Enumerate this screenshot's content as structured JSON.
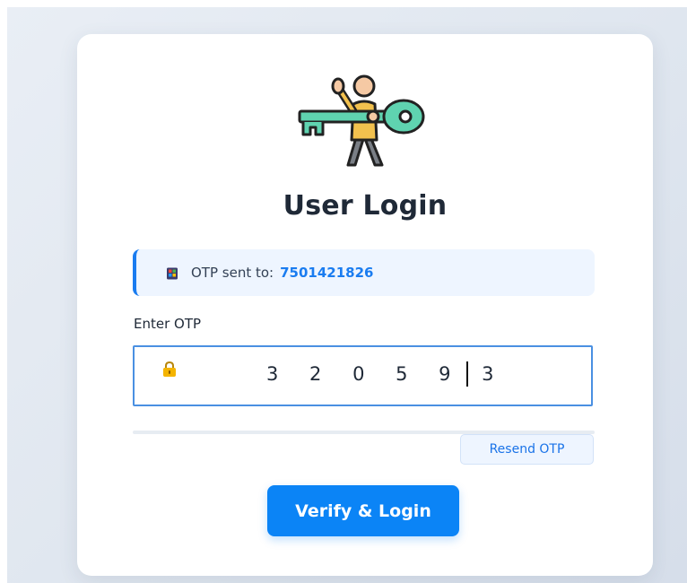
{
  "header": {
    "title": "User Login",
    "logo_icon": "user-with-key-icon"
  },
  "info": {
    "label": "OTP sent to:",
    "phone": "7501421826",
    "icon": "phone-icon"
  },
  "otp": {
    "label": "Enter OTP",
    "value": "3 2 0 5 9 3",
    "icon": "lock-icon"
  },
  "actions": {
    "resend_label": "Resend OTP",
    "verify_label": "Verify & Login"
  },
  "colors": {
    "accent": "#0b84f6",
    "link": "#1a7cf0",
    "info_bg": "#eef5ff",
    "title": "#1f2937",
    "page_bg": "#dfe6ef"
  }
}
